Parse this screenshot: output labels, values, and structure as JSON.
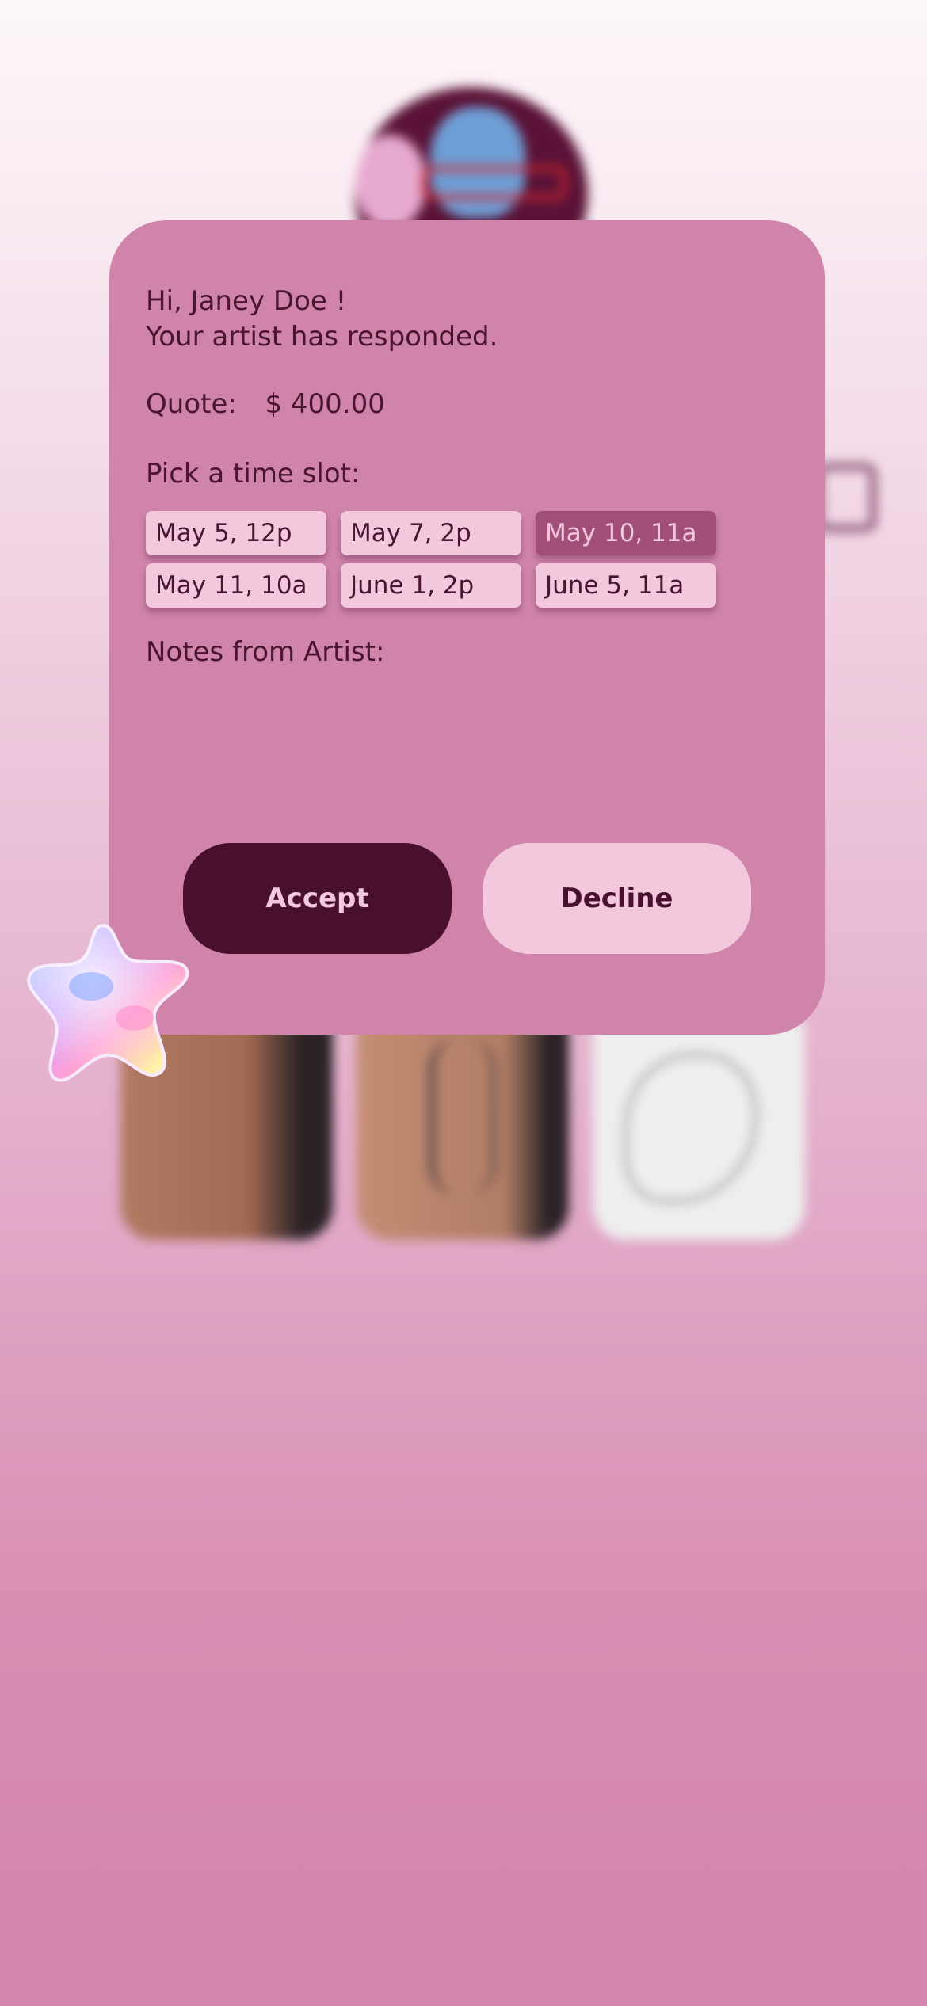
{
  "modal": {
    "greeting_line1": "Hi, Janey Doe !",
    "greeting_line2": "Your artist has responded.",
    "quote_label": "Quote:",
    "quote_value": "$ 400.00",
    "slots_title": "Pick a time slot:",
    "time_slots": [
      {
        "label": "May 5, 12p",
        "selected": false
      },
      {
        "label": "May 7, 2p",
        "selected": false
      },
      {
        "label": "May 10, 11a",
        "selected": true
      },
      {
        "label": "May 11, 10a",
        "selected": false
      },
      {
        "label": "June 1, 2p",
        "selected": false
      },
      {
        "label": "June 5, 11a",
        "selected": false
      }
    ],
    "notes_title": "Notes from Artist:",
    "notes_text": "",
    "accept_label": "Accept",
    "decline_label": "Decline"
  },
  "colors": {
    "card": "#d084aa",
    "text": "#4a1530",
    "accent_dark": "#48102d",
    "slot": "#f3c8dc",
    "slot_selected": "#a14f78"
  },
  "icons": {
    "sticker": "star-sticker-icon",
    "avatar": "artist-avatar"
  }
}
